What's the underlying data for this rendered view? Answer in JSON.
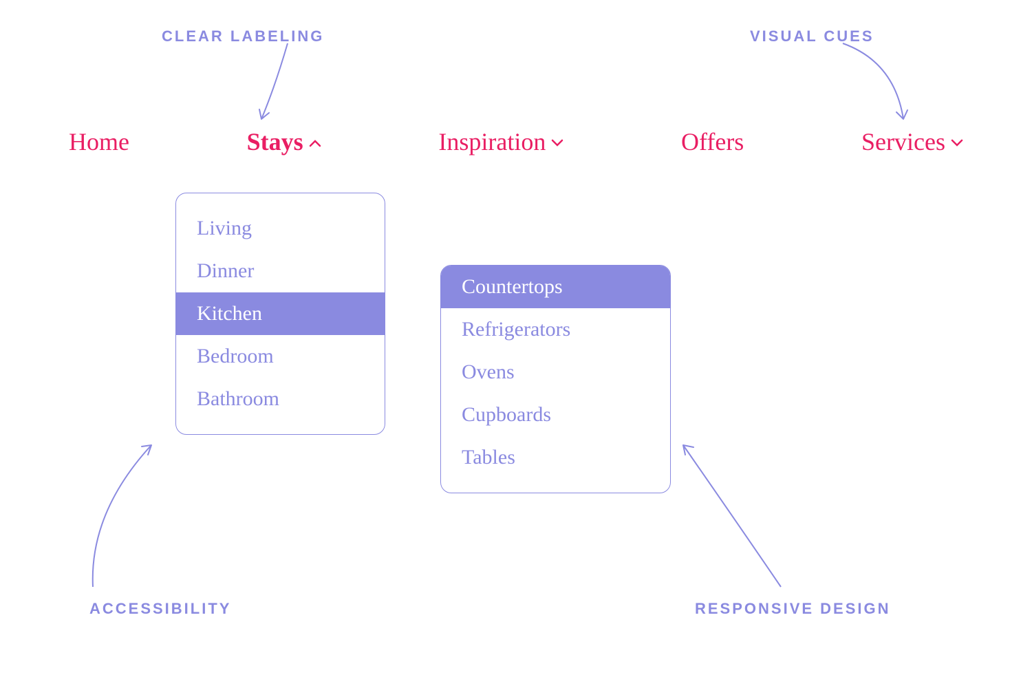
{
  "annotations": {
    "clear_labeling": "CLEAR LABELING",
    "visual_cues": "VISUAL CUES",
    "accessibility": "ACCESSIBILITY",
    "responsive_design": "RESPONSIVE DESIGN"
  },
  "nav": {
    "home": "Home",
    "stays": "Stays",
    "inspiration": "Inspiration",
    "offers": "Offers",
    "services": "Services"
  },
  "dropdown_primary": {
    "living": "Living",
    "dinner": "Dinner",
    "kitchen": "Kitchen",
    "bedroom": "Bedroom",
    "bathroom": "Bathroom"
  },
  "dropdown_secondary": {
    "countertops": "Countertops",
    "refrigerators": "Refrigerators",
    "ovens": "Ovens",
    "cupboards": "Cupboards",
    "tables": "Tables"
  }
}
